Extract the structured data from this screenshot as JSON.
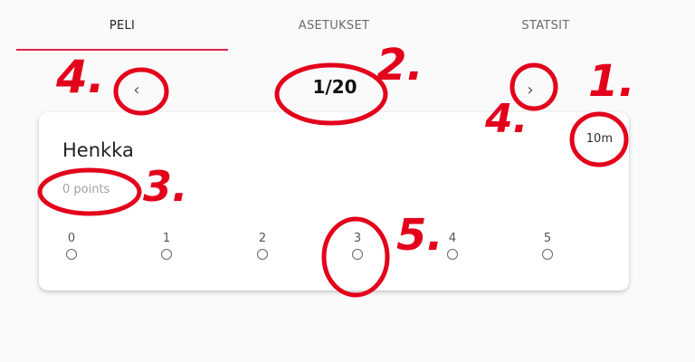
{
  "tabs": [
    {
      "label": "PELI",
      "active": true
    },
    {
      "label": "ASETUKSET",
      "active": false
    },
    {
      "label": "STATSIT",
      "active": false
    }
  ],
  "nav": {
    "prev_icon": "chevron-left-icon",
    "next_icon": "chevron-right-icon",
    "hole_counter": "1/20"
  },
  "player": {
    "name": "Henkka",
    "points": "0 points",
    "distance": "10m"
  },
  "score_options": [
    "0",
    "1",
    "2",
    "3",
    "4",
    "5"
  ],
  "annotations": {
    "color": "#e3001b",
    "labels": [
      "4.",
      "2.",
      "4.",
      "1.",
      "3.",
      "5."
    ]
  },
  "colors": {
    "accent": "#e0234a",
    "background": "#fafafa",
    "card": "#ffffff"
  }
}
